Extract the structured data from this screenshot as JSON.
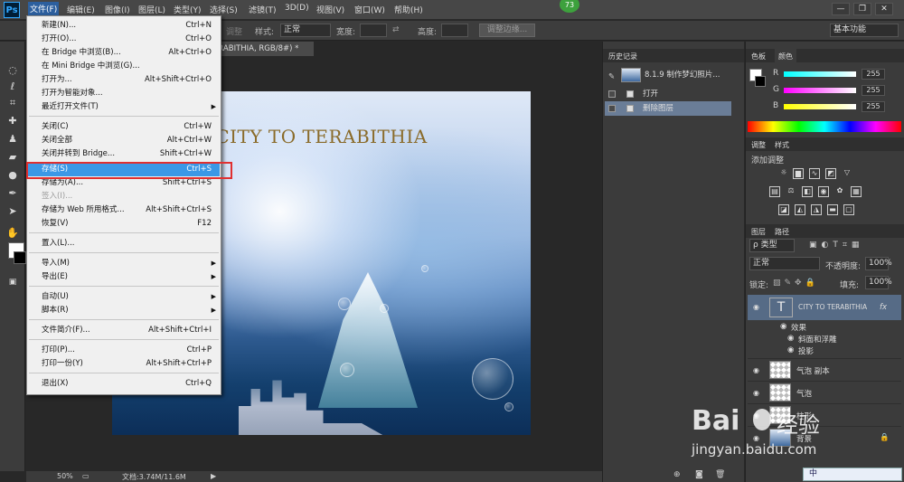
{
  "app": {
    "logo": "Ps",
    "notification_count": "73"
  },
  "menubar": {
    "items": [
      "文件(F)",
      "编辑(E)",
      "图像(I)",
      "图层(L)",
      "类型(Y)",
      "选择(S)",
      "滤镜(T)",
      "3D(D)",
      "视图(V)",
      "窗口(W)",
      "帮助(H)"
    ],
    "window_buttons": [
      "—",
      "❐",
      "✕"
    ]
  },
  "options": {
    "partial_label": "调整",
    "style_label": "样式:",
    "style_value": "正常",
    "width_label": "宽度:",
    "height_label": "高度:",
    "refine_button": "调整边缘...",
    "workspace": "基本功能"
  },
  "document": {
    "tab_title": "ERABITHIA, RGB/8#) *",
    "canvas_title": "CITY TO TERABITHIA"
  },
  "statusbar": {
    "zoom": "50%",
    "doc_info": "文档:3.74M/11.6M"
  },
  "file_menu": {
    "items": [
      {
        "label": "新建(N)...",
        "shortcut": "Ctrl+N"
      },
      {
        "label": "打开(O)...",
        "shortcut": "Ctrl+O"
      },
      {
        "label": "在 Bridge 中浏览(B)...",
        "shortcut": "Alt+Ctrl+O"
      },
      {
        "label": "在 Mini Bridge 中浏览(G)...",
        "shortcut": ""
      },
      {
        "label": "打开为...",
        "shortcut": "Alt+Shift+Ctrl+O"
      },
      {
        "label": "打开为智能对象...",
        "shortcut": ""
      },
      {
        "label": "最近打开文件(T)",
        "shortcut": "",
        "submenu": true
      },
      {
        "label": "关闭(C)",
        "shortcut": "Ctrl+W"
      },
      {
        "label": "关闭全部",
        "shortcut": "Alt+Ctrl+W"
      },
      {
        "label": "关闭并转到 Bridge...",
        "shortcut": "Shift+Ctrl+W"
      },
      {
        "label": "存储(S)",
        "shortcut": "Ctrl+S",
        "highlighted": true
      },
      {
        "label": "存储为(A)...",
        "shortcut": "Shift+Ctrl+S"
      },
      {
        "label": "签入(I)...",
        "shortcut": "",
        "disabled": true
      },
      {
        "label": "存储为 Web 所用格式...",
        "shortcut": "Alt+Shift+Ctrl+S"
      },
      {
        "label": "恢复(V)",
        "shortcut": "F12"
      },
      {
        "label": "置入(L)...",
        "shortcut": ""
      },
      {
        "label": "导入(M)",
        "shortcut": "",
        "submenu": true
      },
      {
        "label": "导出(E)",
        "shortcut": "",
        "submenu": true
      },
      {
        "label": "自动(U)",
        "shortcut": "",
        "submenu": true
      },
      {
        "label": "脚本(R)",
        "shortcut": "",
        "submenu": true
      },
      {
        "label": "文件简介(F)...",
        "shortcut": "Alt+Shift+Ctrl+I"
      },
      {
        "label": "打印(P)...",
        "shortcut": "Ctrl+P"
      },
      {
        "label": "打印一份(Y)",
        "shortcut": "Alt+Shift+Ctrl+P"
      },
      {
        "label": "退出(X)",
        "shortcut": "Ctrl+Q"
      }
    ]
  },
  "history": {
    "tab": "历史记录",
    "snapshot_label": "8.1.9 制作梦幻照片...",
    "items": [
      "打开",
      "删除图层"
    ],
    "selected": "删除图层"
  },
  "color_panel": {
    "tabs": [
      "色板",
      "颜色"
    ],
    "channels": [
      {
        "name": "R",
        "value": "255",
        "color": "#ff3030"
      },
      {
        "name": "G",
        "value": "255",
        "color": "#30ff30"
      },
      {
        "name": "B",
        "value": "255",
        "color": "#3030ff"
      }
    ]
  },
  "adjustments": {
    "tabs": [
      "调整",
      "样式"
    ],
    "title": "添加调整"
  },
  "layers": {
    "tabs": [
      "图层",
      "路径"
    ],
    "filter_kind": "ρ 类型",
    "blend_mode": "正常",
    "opacity_label": "不透明度:",
    "opacity_value": "100%",
    "lock_label": "锁定:",
    "fill_label": "填充:",
    "fill_value": "100%",
    "text_layer": "CITY TO TERABITHIA",
    "fx_label": "fx",
    "effects_label": "效果",
    "effect_items": [
      "斜面和浮雕",
      "投影"
    ],
    "other_layers": [
      "气泡 副本",
      "气泡",
      "柱形",
      "背景"
    ]
  },
  "watermark": {
    "brand": "Bai",
    "brand_suffix": "经验",
    "url": "jingyan.baidu.com",
    "bottom_bar_label": "中"
  }
}
